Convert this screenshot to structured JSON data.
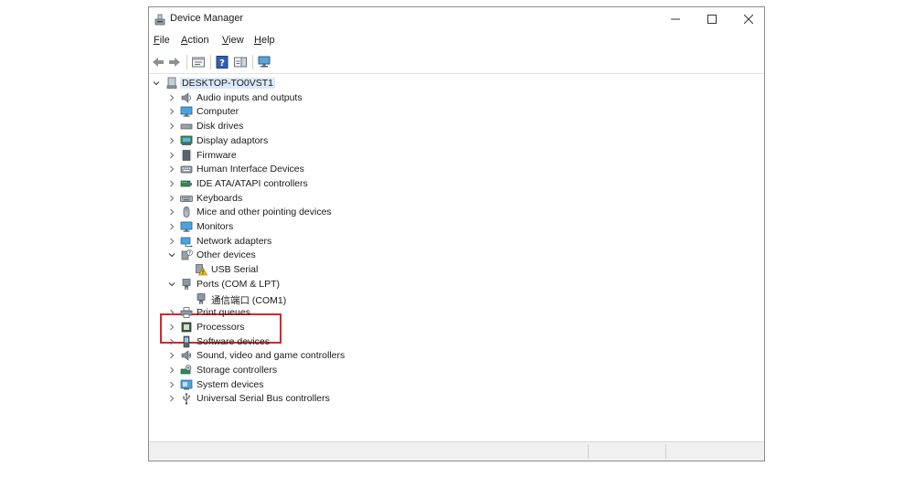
{
  "window": {
    "title": "Device Manager"
  },
  "menu": [
    {
      "label": "File",
      "accel": "F",
      "rest": "ile"
    },
    {
      "label": "Action",
      "accel": "A",
      "rest": "ction"
    },
    {
      "label": "View",
      "accel": "V",
      "rest": "iew"
    },
    {
      "label": "Help",
      "accel": "H",
      "rest": "elp"
    }
  ],
  "tree": {
    "root": "DESKTOP-TO0VST1",
    "categories": [
      {
        "label": "Audio inputs and outputs",
        "icon": "speaker-icon",
        "expanded": false
      },
      {
        "label": "Computer",
        "icon": "monitor-icon",
        "expanded": false
      },
      {
        "label": "Disk drives",
        "icon": "disk-drive-icon",
        "expanded": false
      },
      {
        "label": "Display adaptors",
        "icon": "display-adapter-icon",
        "expanded": false
      },
      {
        "label": "Firmware",
        "icon": "firmware-icon",
        "expanded": false
      },
      {
        "label": "Human Interface Devices",
        "icon": "hid-icon",
        "expanded": false
      },
      {
        "label": "IDE ATA/ATAPI controllers",
        "icon": "ide-controller-icon",
        "expanded": false
      },
      {
        "label": "Keyboards",
        "icon": "keyboard-icon",
        "expanded": false
      },
      {
        "label": "Mice and other pointing devices",
        "icon": "mouse-icon",
        "expanded": false
      },
      {
        "label": "Monitors",
        "icon": "monitor-icon",
        "expanded": false
      },
      {
        "label": "Network adapters",
        "icon": "network-adapter-icon",
        "expanded": false
      },
      {
        "label": "Other devices",
        "icon": "unknown-device-icon",
        "expanded": true,
        "children": [
          {
            "label": "USB Serial",
            "icon": "warning-device-icon"
          }
        ]
      },
      {
        "label": "Ports (COM & LPT)",
        "icon": "port-icon",
        "expanded": true,
        "children": [
          {
            "label": "通信端口 (COM1)",
            "icon": "port-icon"
          }
        ]
      },
      {
        "label": "Print queues",
        "icon": "printer-icon",
        "expanded": false
      },
      {
        "label": "Processors",
        "icon": "processor-icon",
        "expanded": false
      },
      {
        "label": "Software devices",
        "icon": "software-device-icon",
        "expanded": false
      },
      {
        "label": "Sound, video and game controllers",
        "icon": "sound-icon",
        "expanded": false
      },
      {
        "label": "Storage controllers",
        "icon": "storage-controller-icon",
        "expanded": false
      },
      {
        "label": "System devices",
        "icon": "system-device-icon",
        "expanded": false
      },
      {
        "label": "Universal Serial Bus controllers",
        "icon": "usb-icon",
        "expanded": false
      }
    ]
  },
  "colors": {
    "highlight_box": "#d9252d",
    "root_selection": "#dbe9f9"
  }
}
